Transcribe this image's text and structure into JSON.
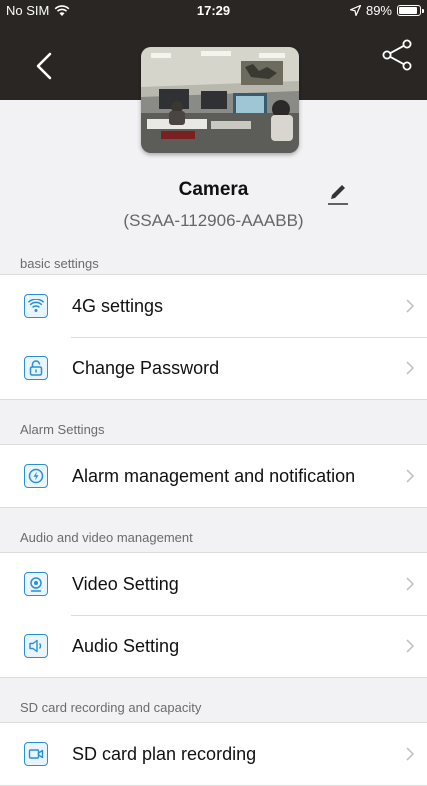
{
  "status": {
    "carrier": "No SIM",
    "time": "17:29",
    "battery": "89%"
  },
  "device": {
    "name": "Camera",
    "id": "(SSAA-112906-AAABB)"
  },
  "sections": [
    {
      "title": "basic settings",
      "items": [
        {
          "label": "4G settings",
          "icon": "wifi-icon"
        },
        {
          "label": "Change Password",
          "icon": "lock-icon"
        }
      ]
    },
    {
      "title": "Alarm Settings",
      "items": [
        {
          "label": "Alarm management and notification",
          "icon": "alarm-icon"
        }
      ]
    },
    {
      "title": "Audio and video management",
      "items": [
        {
          "label": "Video Setting",
          "icon": "video-icon"
        },
        {
          "label": "Audio Setting",
          "icon": "audio-icon"
        }
      ]
    },
    {
      "title": "SD card recording and capacity",
      "items": [
        {
          "label": "SD card plan recording",
          "icon": "recording-icon"
        }
      ]
    }
  ],
  "colors": {
    "accent": "#2b8fd6",
    "header": "#2a2624",
    "background": "#f2f2f4"
  }
}
